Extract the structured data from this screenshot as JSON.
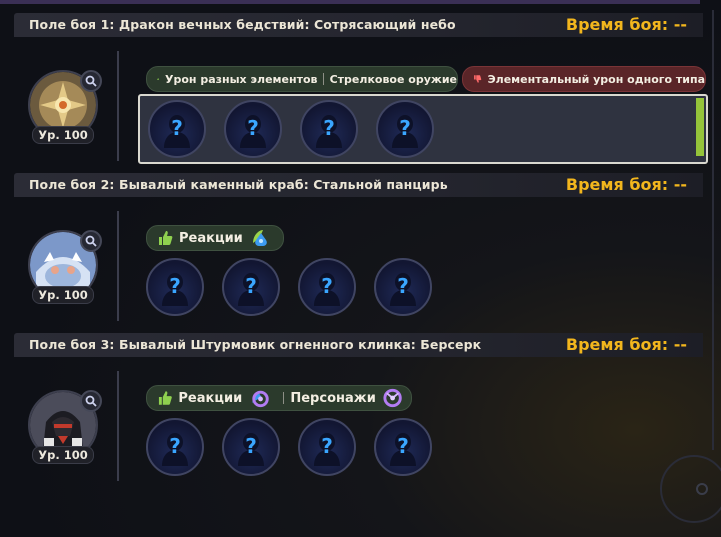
{
  "stages": [
    {
      "header": {
        "title": "Поле боя 1: Дракон вечных бедствий: Сотрясающий небо",
        "time": "Время боя: --"
      },
      "boss": {
        "level": "Ур. 100",
        "icon": "dragon-boss-icon"
      },
      "tags": [
        {
          "type": "good",
          "parts": [
            "Урон разных элементов",
            "Стрелковое оружие"
          ]
        },
        {
          "type": "bad",
          "parts": [
            "Элементальный урон одного типа"
          ]
        }
      ],
      "slots": 4
    },
    {
      "header": {
        "title": "Поле боя 2: Бывалый каменный краб: Стальной панцирь",
        "time": "Время боя: --"
      },
      "boss": {
        "level": "Ур. 100",
        "icon": "crab-boss-icon"
      },
      "tags": [
        {
          "type": "good",
          "parts": [
            "Реакции"
          ],
          "elements": [
            "dendro-hydro"
          ]
        }
      ],
      "slots": 4
    },
    {
      "header": {
        "title": "Поле боя 3: Бывалый Штурмовик огненного клинка: Берсерк",
        "time": "Время боя: --"
      },
      "boss": {
        "level": "Ур. 100",
        "icon": "fire-blade-boss-icon"
      },
      "tags": [
        {
          "type": "good",
          "parts": [
            "Реакции",
            "Персонажи"
          ],
          "elements": [
            "hydro-electro",
            "electro"
          ]
        }
      ],
      "slots": 4
    }
  ],
  "colors": {
    "accent": "#f2b61d",
    "good": "#2b3a2c",
    "bad": "#5a2528",
    "selected_bar": "#95c43a"
  }
}
